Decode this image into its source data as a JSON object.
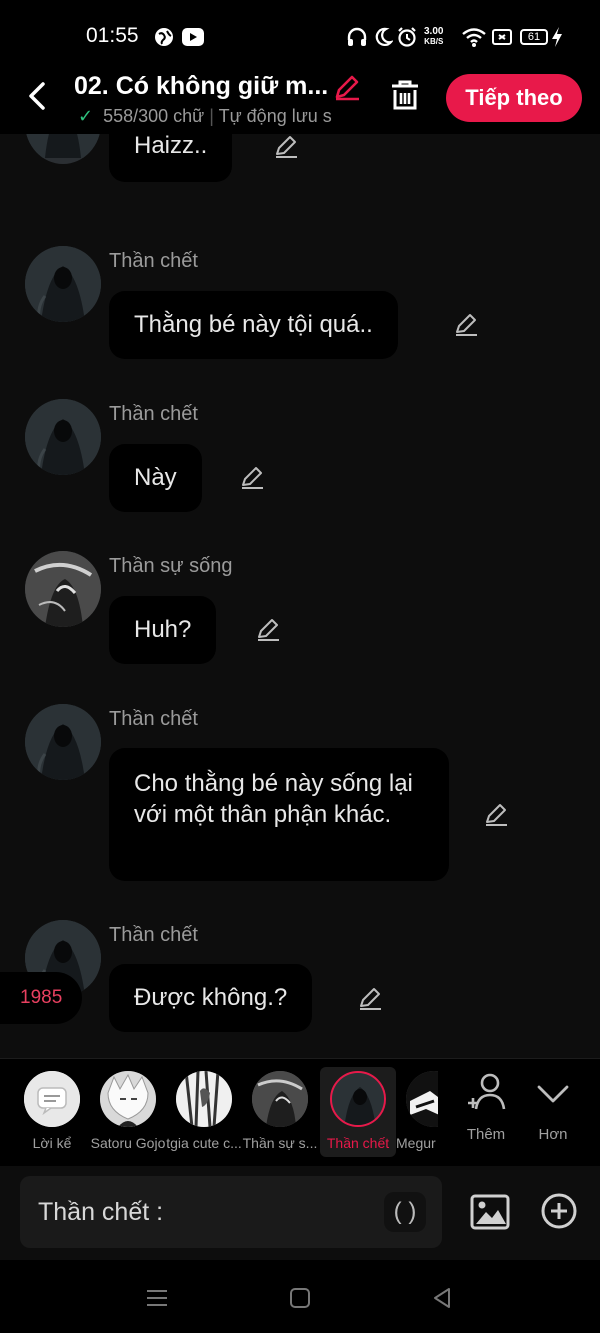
{
  "status_bar": {
    "time": "01:55",
    "net_speed_value": "3.00",
    "net_speed_unit": "KB/S",
    "battery": "61"
  },
  "header": {
    "title": "02. Có không giữ m...",
    "word_count": "558/300 chữ",
    "separator": "|",
    "autosave": "Tự động lưu s",
    "next_label": "Tiếp theo"
  },
  "messages": [
    {
      "sender": "",
      "text": "Haizz..",
      "avatar": "than-chet"
    },
    {
      "sender": "Thần chết",
      "text": "Thằng bé này tội quá..",
      "avatar": "than-chet"
    },
    {
      "sender": "Thần chết",
      "text": "Này",
      "avatar": "than-chet"
    },
    {
      "sender": "Thần sự sống",
      "text": "Huh?",
      "avatar": "than-su-song"
    },
    {
      "sender": "Thần chết",
      "text": "Cho thằng bé này sống lại với một thân phận khác.",
      "avatar": "than-chet"
    },
    {
      "sender": "Thần chết",
      "text": "Được không.?",
      "avatar": "than-chet"
    }
  ],
  "year_badge": "1985",
  "characters": [
    {
      "label": "Lời kể",
      "active": false
    },
    {
      "label": "Satoru Gojo",
      "active": false
    },
    {
      "label": "tgia cute c...",
      "active": false
    },
    {
      "label": "Thần sự s...",
      "active": false
    },
    {
      "label": "Thần chết",
      "active": true
    },
    {
      "label": "Megur",
      "active": false
    }
  ],
  "strip_actions": {
    "add_label": "Thêm",
    "more_label": "Hơn"
  },
  "input": {
    "speaker_label": "Thần chết :",
    "paren_label": "( )"
  },
  "colors": {
    "accent": "#e8194a",
    "bubble": "#000000",
    "background": "#0d0d0d"
  }
}
